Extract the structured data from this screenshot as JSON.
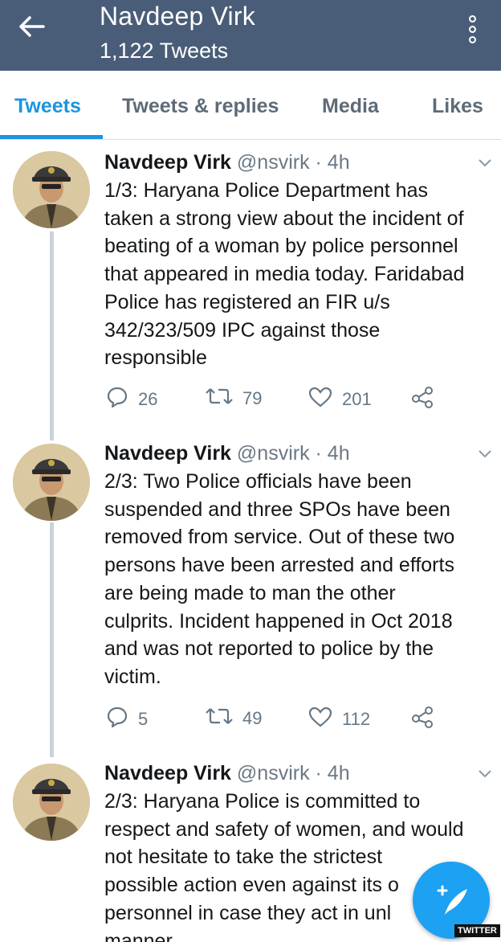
{
  "header": {
    "name": "Navdeep Virk",
    "tweet_count": "1,122 Tweets",
    "back_icon": "arrow-left-icon",
    "menu_icon": "overflow-menu-icon"
  },
  "tabs": [
    {
      "label": "Tweets",
      "active": true
    },
    {
      "label": "Tweets & replies",
      "active": false
    },
    {
      "label": "Media",
      "active": false
    },
    {
      "label": "Likes",
      "active": false
    }
  ],
  "tweets": [
    {
      "name": "Navdeep Virk",
      "handle": "@nsvirk · 4h",
      "lines": [
        "1/3: Haryana Police Department has",
        "taken a strong view about the incident of",
        "beating of a woman by police personnel",
        "that appeared in media today. Faridabad",
        "Police has registered an FIR u/s",
        "342/323/509 IPC against those",
        "responsible"
      ],
      "replies": "26",
      "retweets": "79",
      "likes": "201"
    },
    {
      "name": "Navdeep Virk",
      "handle": "@nsvirk · 4h",
      "lines": [
        "2/3: Two Police officials have been",
        "suspended and three SPOs have been",
        "removed from service. Out of these two",
        "persons have been arrested and efforts",
        "are being made to man the other",
        "culprits. Incident happened in Oct 2018",
        "and was not reported to police by the",
        "victim."
      ],
      "replies": "5",
      "retweets": "49",
      "likes": "112"
    },
    {
      "name": "Navdeep Virk",
      "handle": "@nsvirk · 4h",
      "lines": [
        "2/3: Haryana Police is committed to",
        "respect and safety of women, and would",
        "not hesitate to take the strictest",
        "possible action even against its o",
        "personnel in case they act in unl",
        "manner"
      ]
    }
  ],
  "fab": {
    "icon": "compose-tweet-icon",
    "label": "+"
  },
  "watermark": "TWITTER",
  "colors": {
    "header_bg": "#4a5d78",
    "accent": "#1b95e0",
    "muted": "#657786",
    "thread_line": "#c9d3db"
  }
}
